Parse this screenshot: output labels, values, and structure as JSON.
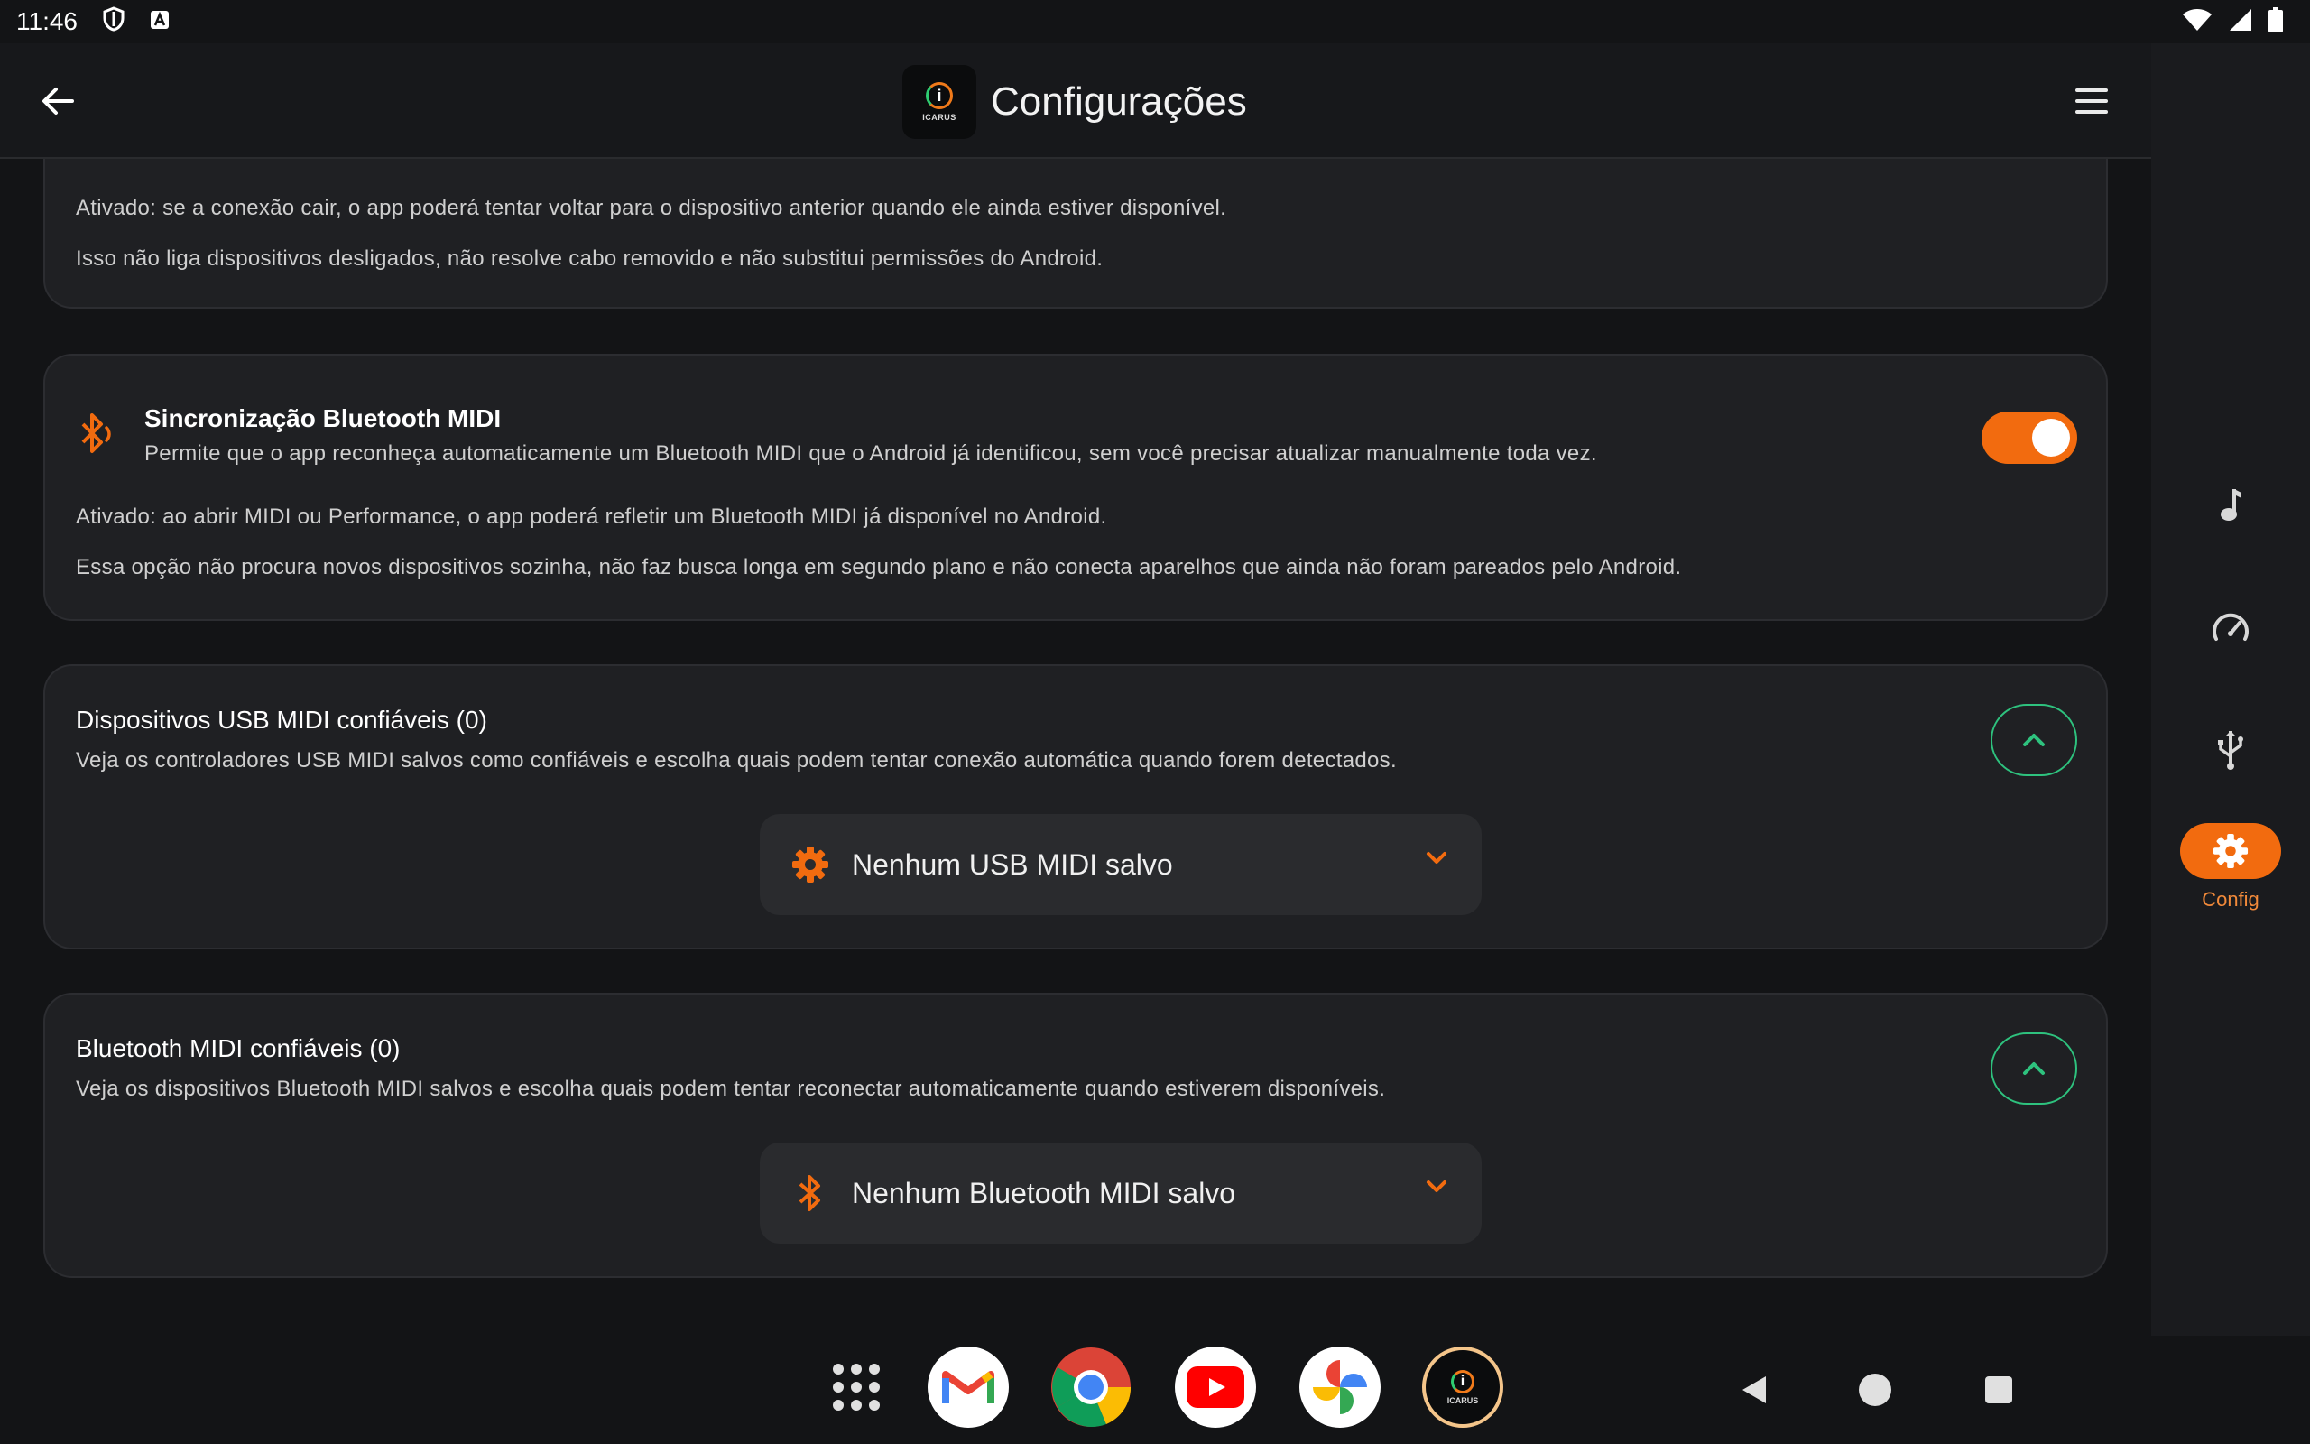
{
  "status_bar": {
    "time": "11:46"
  },
  "app_bar": {
    "title": "Configurações",
    "logo_text": "ICARUS"
  },
  "cards": {
    "fallback": {
      "line1": "Ativado: se a conexão cair, o app poderá tentar voltar para o dispositivo anterior quando ele ainda estiver disponível.",
      "line2": "Isso não liga dispositivos desligados, não resolve cabo removido e não substitui permissões do Android."
    },
    "bluetooth_sync": {
      "title": "Sincronização Bluetooth MIDI",
      "description": "Permite que o app reconheça automaticamente um Bluetooth MIDI que o Android já identificou, sem você precisar atualizar manualmente toda vez.",
      "line1": "Ativado: ao abrir MIDI ou Performance, o app poderá refletir um Bluetooth MIDI já disponível no Android.",
      "line2": "Essa opção não procura novos dispositivos sozinha, não faz busca longa em segundo plano e não conecta aparelhos que ainda não foram pareados pelo Android.",
      "toggle_on": true
    },
    "usb_trusted": {
      "title": "Dispositivos USB MIDI confiáveis (0)",
      "description": "Veja os controladores USB MIDI salvos como confiáveis e escolha quais podem tentar conexão automática quando forem detectados.",
      "dropdown_label": "Nenhum USB MIDI salvo"
    },
    "bt_trusted": {
      "title": "Bluetooth MIDI confiáveis (0)",
      "description": "Veja os dispositivos Bluetooth MIDI salvos e escolha quais podem tentar reconectar automaticamente quando estiverem disponíveis.",
      "dropdown_label": "Nenhum Bluetooth MIDI salvo"
    }
  },
  "rail": {
    "items": [
      {
        "icon": "music-note-icon"
      },
      {
        "icon": "speedometer-icon"
      },
      {
        "icon": "usb-icon"
      },
      {
        "icon": "gear-icon",
        "label": "Config",
        "active": true
      }
    ]
  },
  "dock": {
    "apps": [
      "apps-grid-icon",
      "gmail-icon",
      "chrome-icon",
      "youtube-icon",
      "photos-icon",
      "icarus-icon"
    ],
    "icarus_label": "ICARUS"
  },
  "colors": {
    "accent": "#f26b0f",
    "green": "#2ec27e",
    "card": "#1f2023",
    "background": "#131416"
  }
}
